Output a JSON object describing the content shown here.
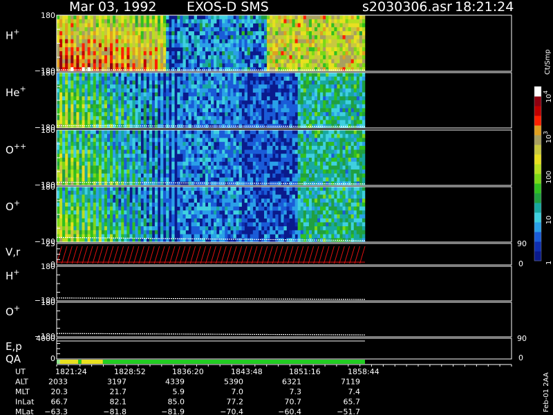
{
  "header": {
    "date": "Mar 03, 1992",
    "instrument": "EXOS-D SMS",
    "file": "s2030306.asr",
    "time": "18:21:24"
  },
  "side_label": "Feb-01 2AA",
  "colors": {
    "background": "#000000",
    "spectrogram_background": "#0a1a8c",
    "axis": "#ffffff",
    "velocity_trace": "#e01010",
    "qa_good": "#22cc22",
    "qa_marginal": "#e8e020"
  },
  "chart_data": {
    "type": "heatmap",
    "x_axis": {
      "label": "UT",
      "ticks": [
        "1821:24",
        "1828:52",
        "1836:20",
        "1843:48",
        "1851:16",
        "1858:44"
      ]
    },
    "panels": [
      {
        "id": "H+",
        "ion": "H",
        "charge": "+",
        "type": "heatmap",
        "ylim": [
          -180,
          180
        ],
        "y_top_label": "180",
        "y_bottom_label": "−180",
        "intensity_profile": "h_plus",
        "trace": [
          -170,
          -172
        ]
      },
      {
        "id": "He+",
        "ion": "He",
        "charge": "+",
        "type": "heatmap",
        "ylim": [
          -180,
          180
        ],
        "y_top_label": "180",
        "y_bottom_label": "−180",
        "intensity_profile": "decaying",
        "trace": [
          -165,
          -170
        ]
      },
      {
        "id": "O++",
        "ion": "O",
        "charge": "++",
        "type": "heatmap",
        "ylim": [
          -180,
          180
        ],
        "y_top_label": "180",
        "y_bottom_label": "−180",
        "intensity_profile": "decaying",
        "trace": [
          -160,
          -170
        ]
      },
      {
        "id": "O+",
        "ion": "O",
        "charge": "+",
        "type": "heatmap",
        "ylim": [
          -180,
          180
        ],
        "y_top_label": "180",
        "y_bottom_label": "−180",
        "intensity_profile": "decaying",
        "trace": [
          -150,
          -170
        ]
      },
      {
        "id": "V,r",
        "label": "V,r",
        "type": "line",
        "ylim": [
          0,
          25
        ],
        "y_top_label": "25",
        "y_bottom_label": "0",
        "right_ticks": [
          "90",
          "0"
        ]
      },
      {
        "id": "H+ line",
        "ion": "H",
        "charge": "+",
        "type": "line",
        "ylim": [
          -180,
          180
        ],
        "y_top_label": "180",
        "y_bottom_label": "−180",
        "trace": [
          -150,
          -165
        ]
      },
      {
        "id": "O+ line",
        "ion": "O",
        "charge": "+",
        "type": "line",
        "ylim": [
          -180,
          180
        ],
        "y_top_label": "180",
        "y_bottom_label": "−180",
        "trace": [
          -145,
          -160
        ]
      },
      {
        "id": "E,p",
        "label": "E,p",
        "type": "line",
        "ylim": [
          0,
          4000
        ],
        "y_top_label": "4000",
        "y_bottom_label": "0",
        "right_ticks": [
          "90",
          "0"
        ]
      },
      {
        "id": "QA",
        "label": "QA",
        "type": "bar"
      }
    ],
    "colorbar": {
      "label": "Ct/Smp",
      "tick_labels": [
        {
          "value": 10000,
          "base": "10",
          "exp": "4"
        },
        {
          "value": 1000,
          "base": "10",
          "exp": "3"
        },
        {
          "value": 100,
          "base": "100",
          "exp": ""
        },
        {
          "value": 10,
          "base": "10",
          "exp": ""
        },
        {
          "value": 1,
          "base": "1",
          "exp": ""
        }
      ],
      "scale": "log",
      "range": [
        1,
        20000
      ],
      "colors": [
        "#0a1a8c",
        "#0f2fb0",
        "#1a5cd8",
        "#2aa0e8",
        "#3fd0e0",
        "#18a8a0",
        "#20a040",
        "#30c020",
        "#7ad818",
        "#b8e020",
        "#e8e020",
        "#c8c840",
        "#a8a060",
        "#e0a020",
        "#ff2000",
        "#c00000",
        "#900010",
        "#ffffff"
      ]
    },
    "ephemeris": [
      {
        "label": "UT",
        "values": [
          "1821:24",
          "1828:52",
          "1836:20",
          "1843:48",
          "1851:16",
          "1858:44"
        ]
      },
      {
        "label": "ALT",
        "values": [
          "2033",
          "3197",
          "4339",
          "5390",
          "6321",
          "7119"
        ]
      },
      {
        "label": "MLT",
        "values": [
          "20.3",
          "21.7",
          "5.9",
          "7.0",
          "7.3",
          "7.4"
        ]
      },
      {
        "label": "InLat",
        "values": [
          "66.7",
          "82.1",
          "85.0",
          "77.2",
          "70.7",
          "65.7"
        ]
      },
      {
        "label": "MLat",
        "values": [
          "−63.3",
          "−81.8",
          "−81.9",
          "−70.4",
          "−60.4",
          "−51.7"
        ]
      }
    ],
    "qa_segments": [
      {
        "from": 0,
        "to": 0.01,
        "status": "good"
      },
      {
        "from": 0.01,
        "to": 0.07,
        "status": "marginal"
      },
      {
        "from": 0.07,
        "to": 0.08,
        "status": "good"
      },
      {
        "from": 0.08,
        "to": 0.15,
        "status": "marginal"
      },
      {
        "from": 0.15,
        "to": 1,
        "status": "good"
      }
    ]
  }
}
